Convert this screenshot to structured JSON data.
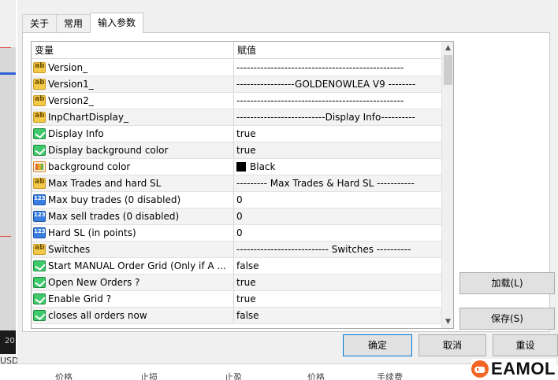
{
  "tabs": [
    {
      "label": "关于"
    },
    {
      "label": "常用"
    },
    {
      "label": "输入参数"
    }
  ],
  "grid": {
    "headers": {
      "variable": "变量",
      "value": "赋值"
    },
    "rows": [
      {
        "icon": "ab",
        "name": "Version_",
        "value": "-------------------------------------------------"
      },
      {
        "icon": "ab",
        "name": "Version1_",
        "value": "-----------------GOLDENOWLEA V9 --------"
      },
      {
        "icon": "ab",
        "name": "Version2_",
        "value": "-------------------------------------------------"
      },
      {
        "icon": "ab",
        "name": "InpChartDisplay_",
        "value": "--------------------------Display Info----------"
      },
      {
        "icon": "bool",
        "name": "Display Info",
        "value": "true"
      },
      {
        "icon": "bool",
        "name": "Display background color",
        "value": "true"
      },
      {
        "icon": "color",
        "name": "background color",
        "value": "Black",
        "swatch": "#000000"
      },
      {
        "icon": "ab",
        "name": "Max Trades and hard SL",
        "value": "--------- Max Trades & Hard SL -----------"
      },
      {
        "icon": "num",
        "name": "Max buy trades (0 disabled)",
        "value": "0"
      },
      {
        "icon": "num",
        "name": "Max sell trades (0 disabled)",
        "value": "0"
      },
      {
        "icon": "num",
        "name": "Hard SL (in points)",
        "value": "0"
      },
      {
        "icon": "ab",
        "name": "Switches",
        "value": "--------------------------- Switches ----------"
      },
      {
        "icon": "bool",
        "name": "Start MANUAL Order  Grid  (Only if A ...",
        "value": "false"
      },
      {
        "icon": "bool",
        "name": "Open New Orders ?",
        "value": "true"
      },
      {
        "icon": "bool",
        "name": "Enable Grid ?",
        "value": "true"
      },
      {
        "icon": "bool",
        "name": "closes all orders now",
        "value": "false"
      }
    ]
  },
  "buttons": {
    "load": "加载(L)",
    "save": "保存(S)",
    "ok": "确定",
    "cancel": "取消",
    "reset": "重设"
  },
  "background": {
    "left_symbol": "USD",
    "left_number": "20",
    "bottom_columns": [
      "价格",
      "止损",
      "止盈",
      "价格",
      "手续费"
    ]
  },
  "logo": {
    "text": "EAMOL",
    "color": "#f26522"
  }
}
